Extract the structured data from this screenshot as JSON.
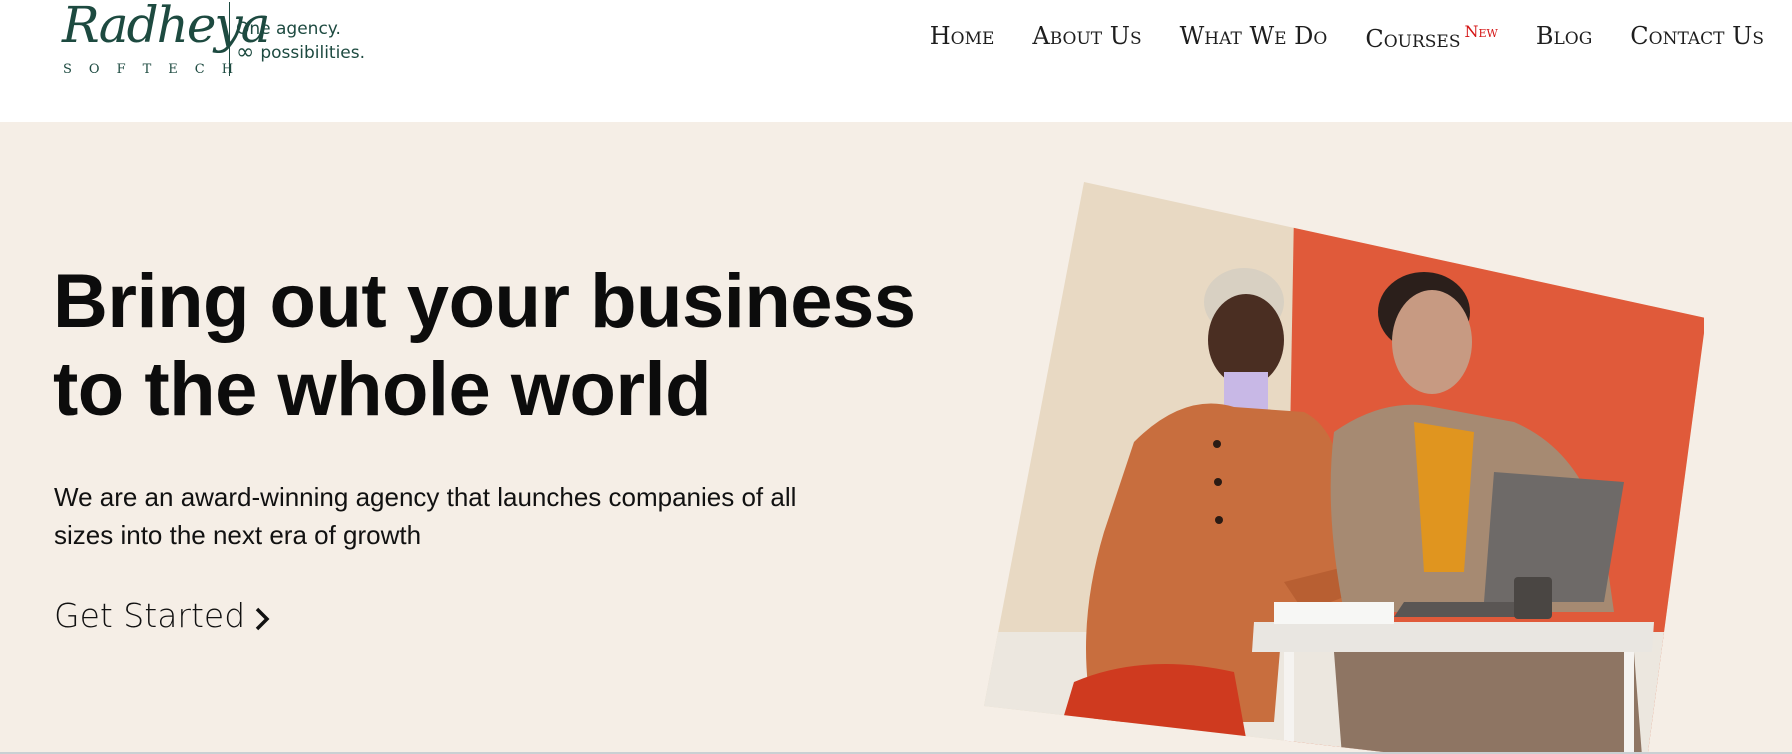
{
  "brand": {
    "script_name": "Radheya",
    "subtitle": "SOFTECH",
    "tagline_line1": "One agency.",
    "tagline_infinity": "∞",
    "tagline_line2": "possibilities."
  },
  "nav": {
    "items": [
      {
        "label": "Home"
      },
      {
        "label": "About Us"
      },
      {
        "label": "What We Do"
      },
      {
        "label": "Courses",
        "badge": "New"
      },
      {
        "label": "Blog"
      },
      {
        "label": "Contact Us"
      }
    ]
  },
  "hero": {
    "title_line1": "Bring out your business",
    "title_line2": "to the whole world",
    "subtitle_line1": "We are an award-winning agency that launches companies of all",
    "subtitle_line2": "sizes into the next era of growth",
    "cta_label": "Get Started",
    "cta_icon": "chevron-right-icon",
    "image_icon": "team-meeting-photo"
  },
  "colors": {
    "brand_green": "#1d4a40",
    "hero_background": "#f5eee6",
    "badge_red": "#d41313",
    "text_dark": "#0c0c0c"
  }
}
